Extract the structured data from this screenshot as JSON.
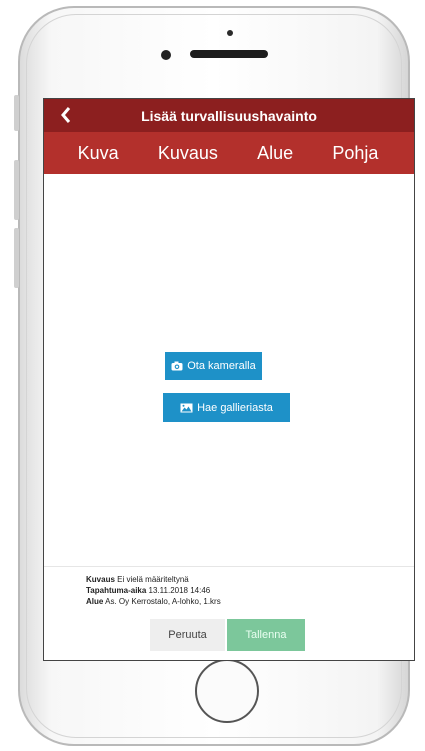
{
  "header": {
    "back_icon": "chevron-left-icon",
    "title": "Lisää turvallisuushavainto"
  },
  "tabs": [
    {
      "label": "Kuva"
    },
    {
      "label": "Kuvaus"
    },
    {
      "label": "Alue"
    },
    {
      "label": "Pohja"
    }
  ],
  "actions": {
    "camera_label": "Ota kameralla",
    "camera_icon": "camera-icon",
    "gallery_label": "Hae gallieriasta",
    "gallery_icon": "image-icon"
  },
  "summary": {
    "description_key": "Kuvaus",
    "description_value": "Ei vielä määriteltynä",
    "time_key": "Tapahtuma-aika",
    "time_value": "13.11.2018 14:46",
    "area_key": "Alue",
    "area_value": "As. Oy Kerrostalo, A-lohko, 1.krs"
  },
  "footer": {
    "cancel_label": "Peruuta",
    "save_label": "Tallenna"
  },
  "colors": {
    "titlebar": "#8c1f1f",
    "tabbar": "#b3302c",
    "primary_button": "#1e91c8",
    "save_button": "#7cc79b"
  }
}
